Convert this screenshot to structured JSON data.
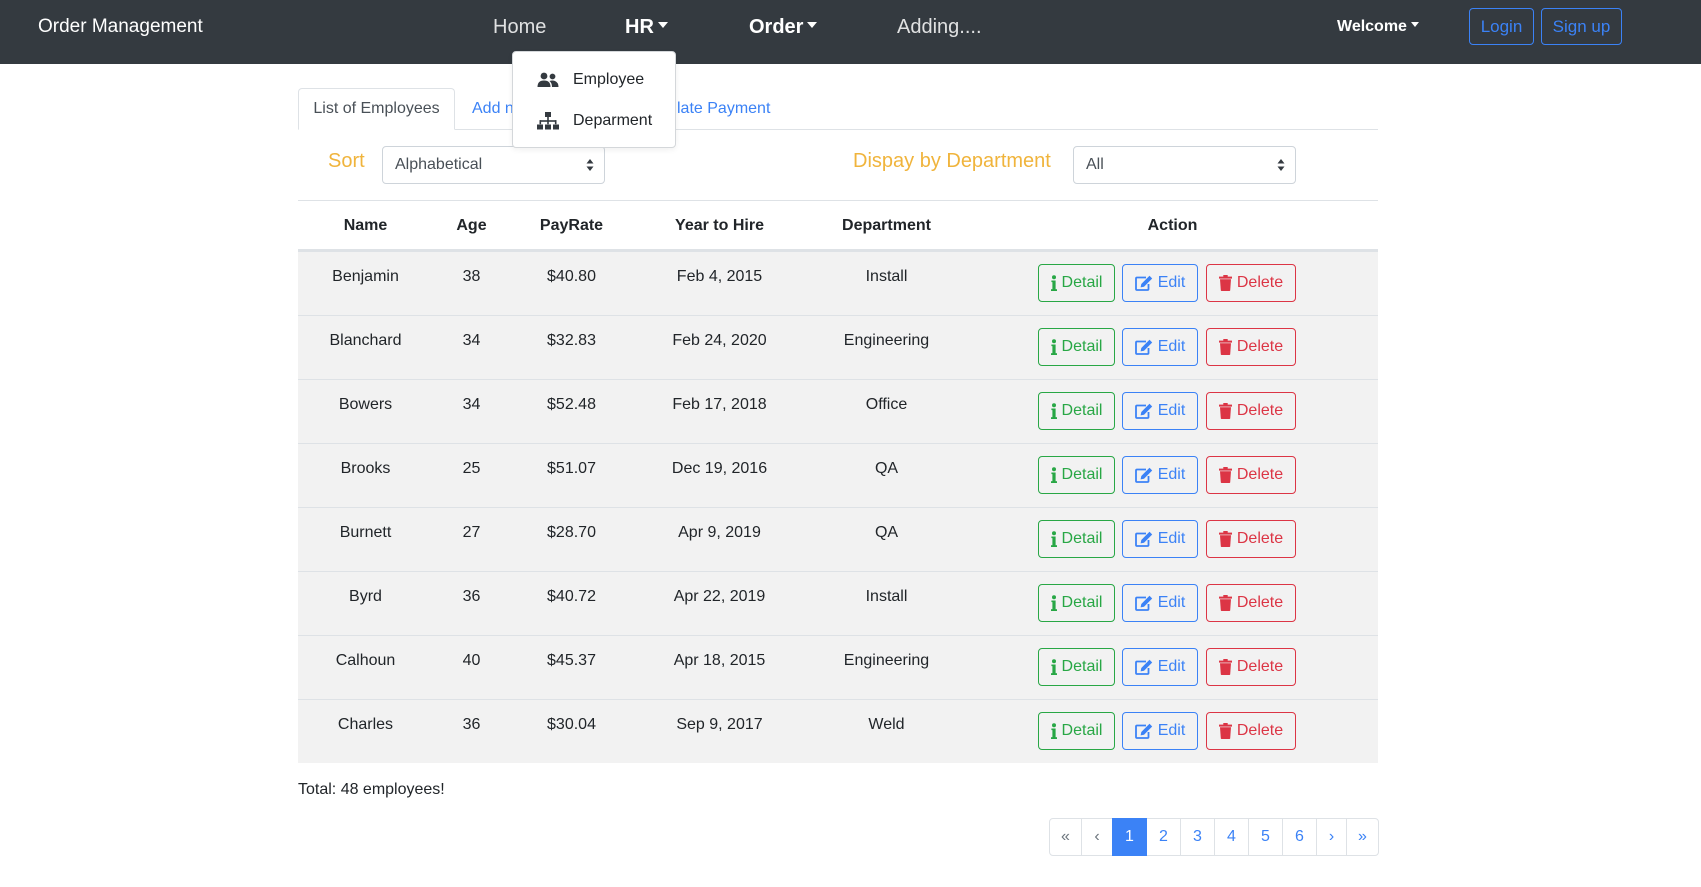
{
  "navbar": {
    "brand": "Order Management",
    "links": [
      {
        "label": "Home"
      },
      {
        "label": "HR"
      },
      {
        "label": "Order"
      },
      {
        "label": "Adding...."
      }
    ],
    "welcome": "Welcome",
    "login": "Login",
    "signup": "Sign up",
    "bg_color": "#343a40"
  },
  "hr_dropdown": {
    "items": [
      {
        "label": "Employee",
        "icon": "users-icon"
      },
      {
        "label": "Deparment",
        "icon": "sitemap-icon"
      }
    ]
  },
  "tabs": {
    "active": "List of Employees",
    "add_partial": "Add n",
    "payment_partial": "late Payment"
  },
  "filters": {
    "sort_label": "Sort",
    "sort_value": "Alphabetical",
    "dept_label": "Dispay by Department",
    "dept_value": "All",
    "label_color": "#f0b43c"
  },
  "table": {
    "columns": [
      "Name",
      "Age",
      "PayRate",
      "Year to Hire",
      "Department",
      "Action"
    ],
    "rows": [
      {
        "name": "Benjamin",
        "age": "38",
        "payrate": "$40.80",
        "hired": "Feb 4, 2015",
        "department": "Install"
      },
      {
        "name": "Blanchard",
        "age": "34",
        "payrate": "$32.83",
        "hired": "Feb 24, 2020",
        "department": "Engineering"
      },
      {
        "name": "Bowers",
        "age": "34",
        "payrate": "$52.48",
        "hired": "Feb 17, 2018",
        "department": "Office"
      },
      {
        "name": "Brooks",
        "age": "25",
        "payrate": "$51.07",
        "hired": "Dec 19, 2016",
        "department": "QA"
      },
      {
        "name": "Burnett",
        "age": "27",
        "payrate": "$28.70",
        "hired": "Apr 9, 2019",
        "department": "QA"
      },
      {
        "name": "Byrd",
        "age": "36",
        "payrate": "$40.72",
        "hired": "Apr 22, 2019",
        "department": "Install"
      },
      {
        "name": "Calhoun",
        "age": "40",
        "payrate": "$45.37",
        "hired": "Apr 18, 2015",
        "department": "Engineering"
      },
      {
        "name": "Charles",
        "age": "36",
        "payrate": "$30.04",
        "hired": "Sep 9, 2017",
        "department": "Weld"
      }
    ],
    "actions": {
      "detail": "Detail",
      "edit": "Edit",
      "delete": "Delete"
    },
    "colors": {
      "detail": "#28a745",
      "edit": "#3b82f6",
      "delete": "#dc3545"
    }
  },
  "total": "Total: 48 employees!",
  "pagination": {
    "first": "«",
    "prev": "‹",
    "pages": [
      "1",
      "2",
      "3",
      "4",
      "5",
      "6"
    ],
    "active_page": "1",
    "next": "›",
    "last": "»"
  }
}
